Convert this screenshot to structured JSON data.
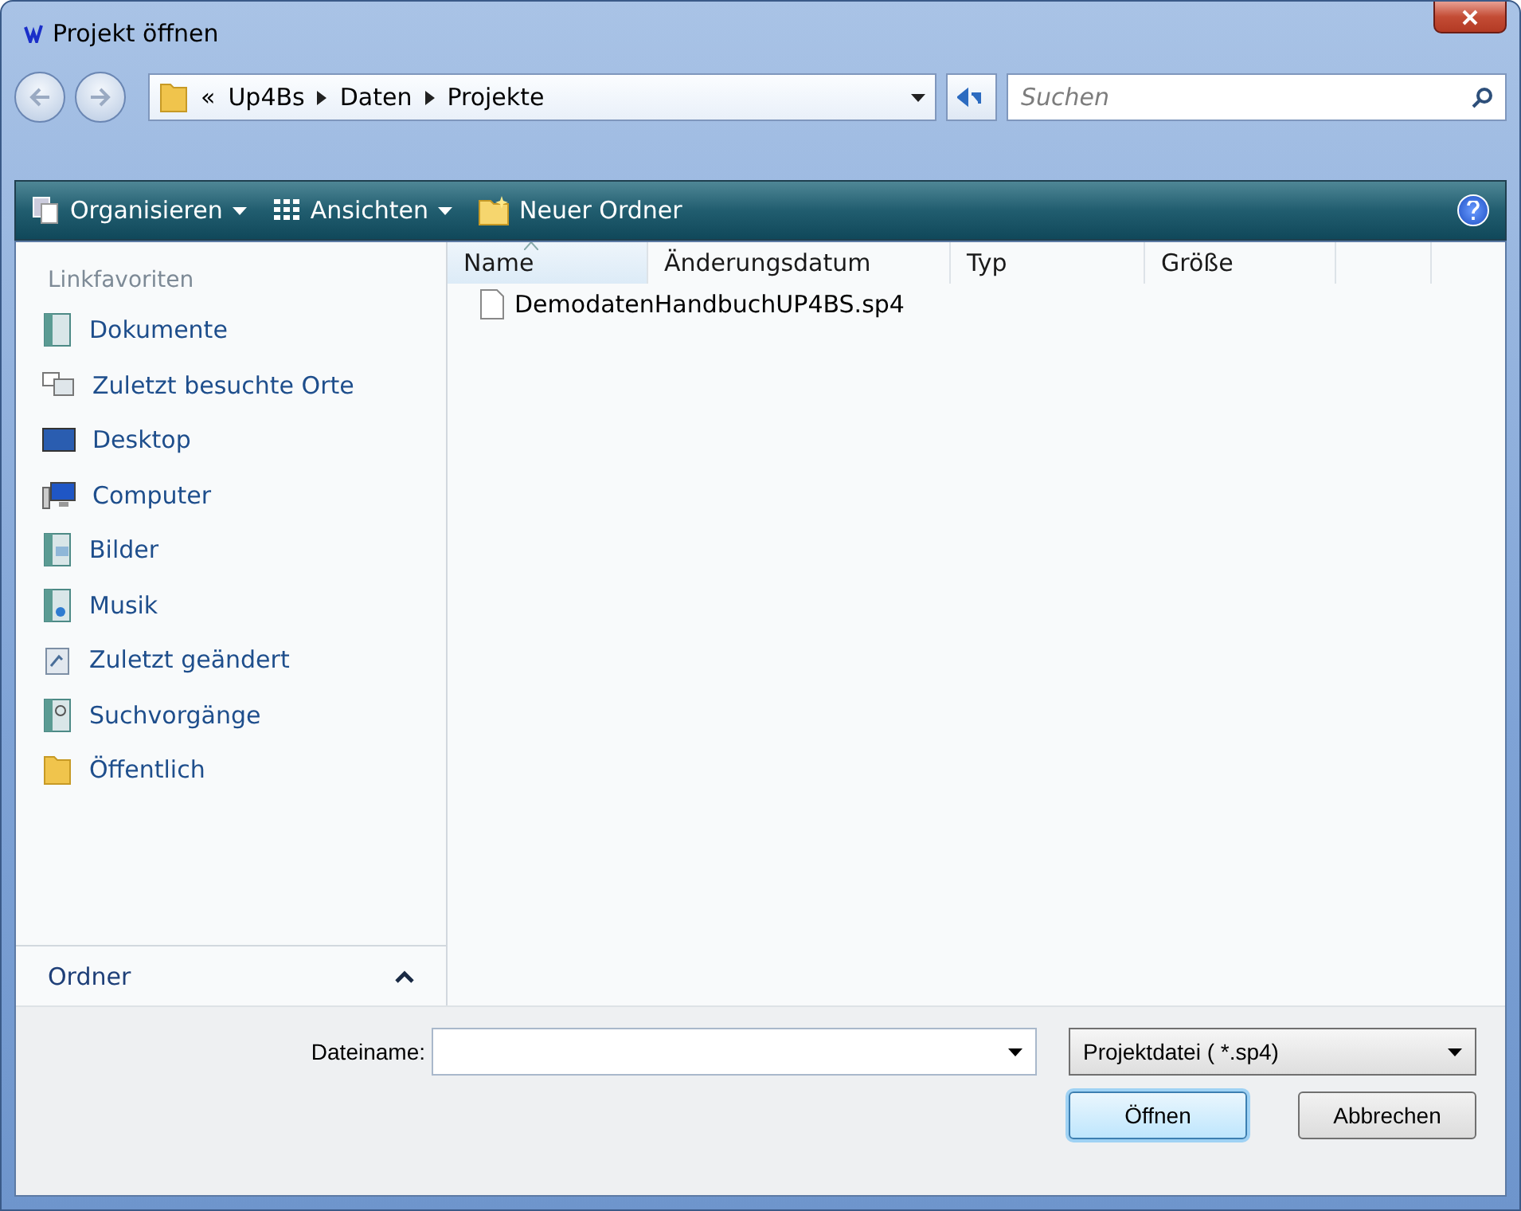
{
  "window": {
    "title": "Projekt öffnen"
  },
  "address": {
    "prefix": "«",
    "crumbs": [
      "Up4Bs",
      "Daten",
      "Projekte"
    ]
  },
  "search": {
    "placeholder": "Suchen"
  },
  "toolbar": {
    "items": [
      {
        "label": "Organisieren",
        "kind": "organize"
      },
      {
        "label": "Ansichten",
        "kind": "views"
      },
      {
        "label": "Neuer Ordner",
        "kind": "newfolder"
      }
    ]
  },
  "sidebar": {
    "heading": "Linkfavoriten",
    "items": [
      {
        "label": "Dokumente",
        "kind": "docs"
      },
      {
        "label": "Zuletzt besuchte Orte",
        "kind": "recent"
      },
      {
        "label": "Desktop",
        "kind": "desktop"
      },
      {
        "label": "Computer",
        "kind": "computer"
      },
      {
        "label": "Bilder",
        "kind": "pictures"
      },
      {
        "label": "Musik",
        "kind": "music"
      },
      {
        "label": "Zuletzt geändert",
        "kind": "changed"
      },
      {
        "label": "Suchvorgänge",
        "kind": "searches"
      },
      {
        "label": "Öffentlich",
        "kind": "public"
      }
    ],
    "folders": {
      "label": "Ordner",
      "expanded": false
    }
  },
  "table": {
    "columns": [
      {
        "label": "Name",
        "sorted": true
      },
      {
        "label": "Änderungsdatum",
        "sorted": false
      },
      {
        "label": "Typ",
        "sorted": false
      },
      {
        "label": "Größe",
        "sorted": false
      }
    ],
    "rows": [
      {
        "name": "DemodatenHandbuchUP4BS.sp4"
      }
    ]
  },
  "footer": {
    "filename_label": "Dateiname:",
    "filetype": "Projektdatei ( *.sp4)",
    "buttons": [
      {
        "label": "Öffnen",
        "kind": "default"
      },
      {
        "label": "Abbrechen",
        "kind": "normal"
      }
    ]
  }
}
